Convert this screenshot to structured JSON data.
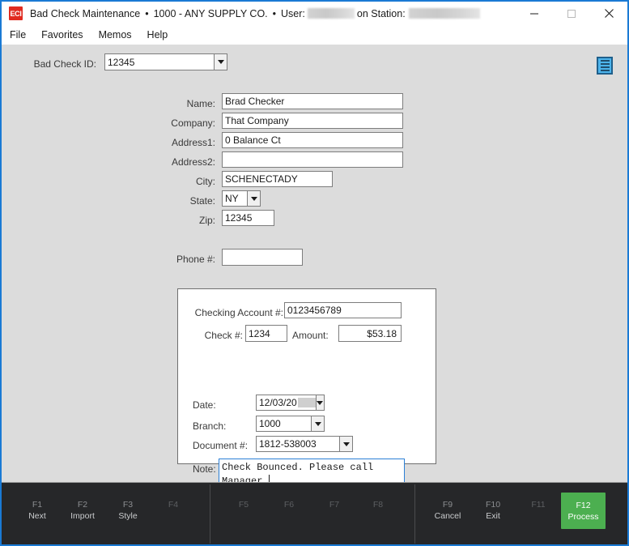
{
  "window": {
    "app_icon_text": "ECI",
    "title": "Bad Check Maintenance",
    "separator": "•",
    "company": "1000 - ANY SUPPLY CO.",
    "user_label": "User:",
    "station_label": "on Station:",
    "minimize_glyph": "–",
    "maximize_glyph": "□",
    "close_glyph": "✕",
    "accent_color": "#1a7ad4"
  },
  "menu": {
    "items": [
      {
        "label": "File"
      },
      {
        "label": "Favorites"
      },
      {
        "label": "Memos"
      },
      {
        "label": "Help"
      }
    ]
  },
  "toolbar": {
    "list_icon_name": "list-document-icon"
  },
  "form": {
    "bad_check_id": {
      "label": "Bad Check ID:",
      "value": "12345"
    },
    "name": {
      "label": "Name:",
      "value": "Brad Checker"
    },
    "company": {
      "label": "Company:",
      "value": "That Company"
    },
    "address1": {
      "label": "Address1:",
      "value": "0 Balance Ct"
    },
    "address2": {
      "label": "Address2:",
      "value": ""
    },
    "city": {
      "label": "City:",
      "value": "SCHENECTADY"
    },
    "state": {
      "label": "State:",
      "value": "NY"
    },
    "zip": {
      "label": "Zip:",
      "value": "12345"
    },
    "phone": {
      "label": "Phone #:",
      "value": ""
    }
  },
  "check_panel": {
    "checking_account": {
      "label": "Checking Account #:",
      "value": "0123456789"
    },
    "check_number": {
      "label": "Check #:",
      "value": "1234"
    },
    "amount": {
      "label": "Amount:",
      "value": "$53.18"
    },
    "date": {
      "label": "Date:",
      "value": "12/03/20"
    },
    "branch": {
      "label": "Branch:",
      "value": "1000"
    },
    "document": {
      "label": "Document #:",
      "value": "1812-538003"
    },
    "note": {
      "label": "Note:",
      "value": "Check Bounced. Please call\nManager."
    }
  },
  "function_bar": {
    "background": "#262729",
    "primary_color": "#4caf50",
    "keys": [
      {
        "key": "F1",
        "name": "Next",
        "state": "enabled"
      },
      {
        "key": "F2",
        "name": "Import",
        "state": "enabled"
      },
      {
        "key": "F3",
        "name": "Style",
        "state": "enabled"
      },
      {
        "key": "F4",
        "name": "",
        "state": "disabled"
      },
      {
        "key": "F5",
        "name": "",
        "state": "disabled"
      },
      {
        "key": "F6",
        "name": "",
        "state": "disabled"
      },
      {
        "key": "F7",
        "name": "",
        "state": "disabled"
      },
      {
        "key": "F8",
        "name": "",
        "state": "disabled"
      },
      {
        "key": "F9",
        "name": "Cancel",
        "state": "enabled"
      },
      {
        "key": "F10",
        "name": "Exit",
        "state": "enabled"
      },
      {
        "key": "F11",
        "name": "",
        "state": "disabled"
      },
      {
        "key": "F12",
        "name": "Process",
        "state": "primary"
      }
    ]
  }
}
